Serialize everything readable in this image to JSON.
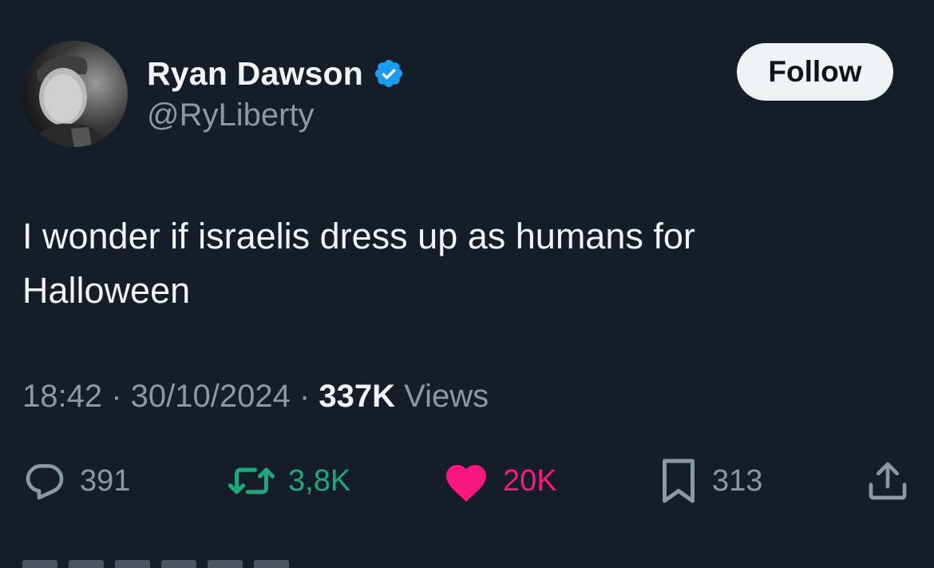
{
  "author": {
    "name": "Ryan Dawson",
    "handle": "@RyLiberty",
    "verified": true,
    "avatar_icon": "profile-photo"
  },
  "follow_button": {
    "label": "Follow"
  },
  "tweet": {
    "line1": "I wonder if israelis dress up as humans for",
    "line2": "Halloween"
  },
  "meta": {
    "time": "18:42",
    "separator1": " · ",
    "date": "30/10/2024",
    "separator2": " · ",
    "views_count": "337K",
    "views_label": " Views"
  },
  "actions": {
    "replies": "391",
    "reposts": "3,8K",
    "likes": "20K",
    "bookmarks": "313"
  },
  "colors": {
    "background": "#151d28",
    "verified_blue": "#1d9bf0",
    "repost_green": "#1fa87a",
    "like_pink": "#f91880",
    "muted_gray": "#8b98a5"
  }
}
